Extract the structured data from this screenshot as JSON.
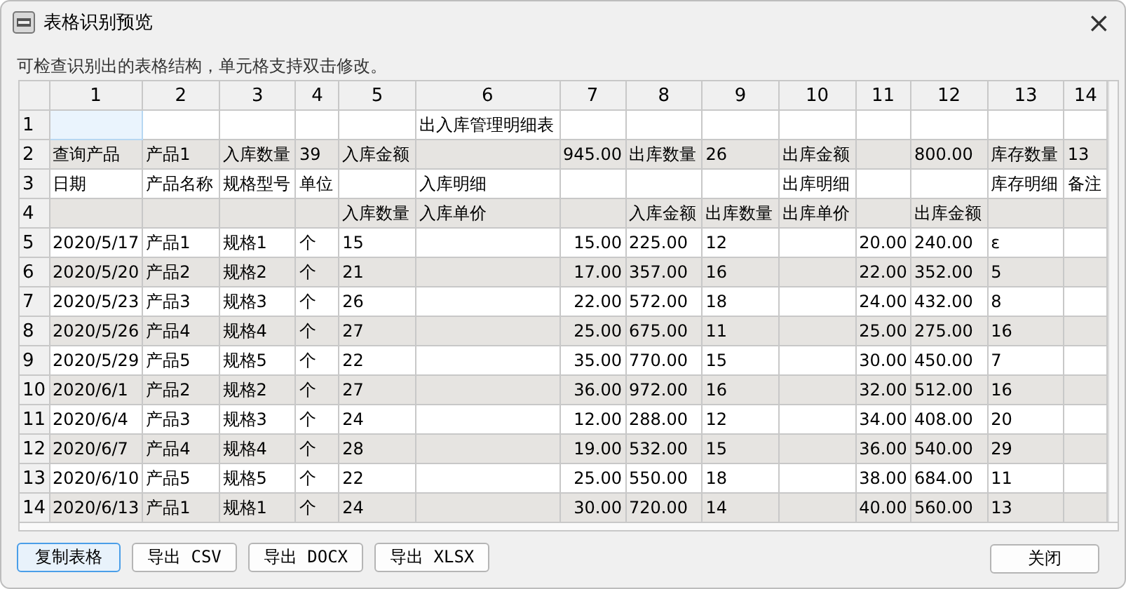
{
  "window": {
    "title": "表格识别预览",
    "close": "×"
  },
  "description": "可检查识别出的表格结构，单元格支持双击修改。",
  "table": {
    "columns": [
      "1",
      "2",
      "3",
      "4",
      "5",
      "6",
      "7",
      "8",
      "9",
      "10",
      "11",
      "12",
      "13",
      "14"
    ],
    "rows": [
      {
        "header": "1",
        "cells": [
          {
            "selected": true
          },
          null,
          null,
          null,
          null,
          "出入库管理明细表",
          null,
          null,
          null,
          null,
          null,
          null,
          null,
          null
        ]
      },
      {
        "header": "2",
        "cells": [
          "查询产品",
          "产品1",
          "入库数量",
          "39",
          "入库金额",
          null,
          "945.00",
          "出库数量",
          "26",
          "出库金额",
          null,
          "800.00",
          "库存数量",
          "13"
        ]
      },
      {
        "header": "3",
        "cells": [
          "日期",
          "产品名称",
          "规格型号",
          "单位",
          null,
          "入库明细",
          null,
          null,
          null,
          "出库明细",
          null,
          null,
          "库存明细",
          "备注"
        ]
      },
      {
        "header": "4",
        "cells": [
          null,
          null,
          null,
          null,
          "入库数量",
          "入库单价",
          null,
          "入库金额",
          "出库数量",
          "出库单价",
          null,
          "出库金额",
          null,
          null
        ]
      },
      {
        "header": "5",
        "cells": [
          "2020/5/17",
          "产品1",
          "规格1",
          "个",
          "15",
          null,
          "15.00",
          "225.00",
          "12",
          null,
          "20.00",
          "240.00",
          "ε",
          null
        ]
      },
      {
        "header": "6",
        "cells": [
          "2020/5/20",
          "产品2",
          "规格2",
          "个",
          "21",
          null,
          "17.00",
          "357.00",
          "16",
          null,
          "22.00",
          "352.00",
          "5",
          null
        ]
      },
      {
        "header": "7",
        "cells": [
          "2020/5/23",
          "产品3",
          "规格3",
          "个",
          "26",
          null,
          "22.00",
          "572.00",
          "18",
          null,
          "24.00",
          "432.00",
          "8",
          null
        ]
      },
      {
        "header": "8",
        "cells": [
          "2020/5/26",
          "产品4",
          "规格4",
          "个",
          "27",
          null,
          "25.00",
          "675.00",
          "11",
          null,
          "25.00",
          "275.00",
          "16",
          null
        ]
      },
      {
        "header": "9",
        "cells": [
          "2020/5/29",
          "产品5",
          "规格5",
          "个",
          "22",
          null,
          "35.00",
          "770.00",
          "15",
          null,
          "30.00",
          "450.00",
          "7",
          null
        ]
      },
      {
        "header": "10",
        "cells": [
          "2020/6/1",
          "产品2",
          "规格2",
          "个",
          "27",
          null,
          "36.00",
          "972.00",
          "16",
          null,
          "32.00",
          "512.00",
          "16",
          null
        ]
      },
      {
        "header": "11",
        "cells": [
          "2020/6/4",
          "产品3",
          "规格3",
          "个",
          "24",
          null,
          "12.00",
          "288.00",
          "12",
          null,
          "34.00",
          "408.00",
          "20",
          null
        ]
      },
      {
        "header": "12",
        "cells": [
          "2020/6/7",
          "产品4",
          "规格4",
          "个",
          "28",
          null,
          "19.00",
          "532.00",
          "15",
          null,
          "36.00",
          "540.00",
          "29",
          null
        ]
      },
      {
        "header": "13",
        "cells": [
          "2020/6/10",
          "产品5",
          "规格5",
          "个",
          "22",
          null,
          "25.00",
          "550.00",
          "18",
          null,
          "38.00",
          "684.00",
          "11",
          null
        ]
      },
      {
        "header": "14",
        "cells": [
          "2020/6/13",
          "产品1",
          "规格1",
          "个",
          "24",
          null,
          "30.00",
          "720.00",
          "14",
          null,
          "40.00",
          "560.00",
          "13",
          null
        ]
      }
    ]
  },
  "buttons": [
    {
      "label": "复制表格",
      "focused": true
    },
    {
      "label": "导出 CSV",
      "focused": false
    },
    {
      "label": "导出 DOCX",
      "focused": false
    },
    {
      "label": "导出 XLSX",
      "focused": false
    }
  ],
  "close_button": {
    "label": "关闭",
    "focused": false
  }
}
